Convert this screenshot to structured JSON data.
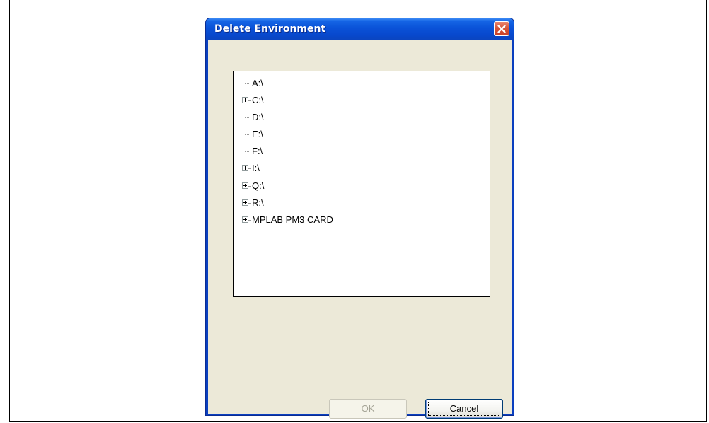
{
  "dialog": {
    "title": "Delete Environment",
    "close_icon": "close-icon",
    "accent_color": "#0a52d8",
    "close_color": "#d8553a"
  },
  "tree": {
    "items": [
      {
        "label": "A:\\",
        "expandable": false
      },
      {
        "label": "C:\\",
        "expandable": true
      },
      {
        "label": "D:\\",
        "expandable": false
      },
      {
        "label": "E:\\",
        "expandable": false
      },
      {
        "label": "F:\\",
        "expandable": false
      },
      {
        "label": "I:\\",
        "expandable": true
      },
      {
        "label": "Q:\\",
        "expandable": true
      },
      {
        "label": "R:\\",
        "expandable": true
      },
      {
        "label": "MPLAB PM3 CARD",
        "expandable": true
      }
    ]
  },
  "buttons": {
    "ok_label": "OK",
    "ok_enabled": false,
    "cancel_label": "Cancel"
  }
}
